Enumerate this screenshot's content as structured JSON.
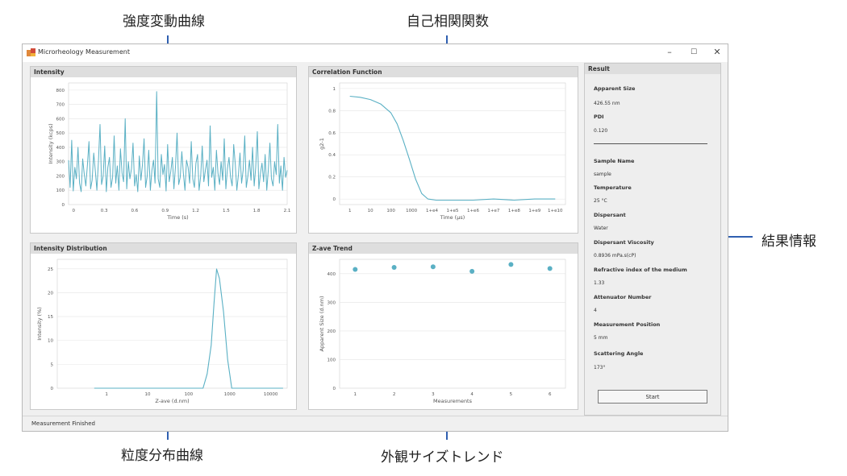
{
  "annotations": {
    "intensity_curve": "強度変動曲線",
    "autocorrelation": "自己相関関数",
    "results_info": "結果情報",
    "size_distribution": "粒度分布曲線",
    "size_trend": "外観サイズトレンド"
  },
  "window": {
    "title": "Microrheology Measurement",
    "minimize": "–",
    "maximize": "☐",
    "close": "✕",
    "status": "Measurement Finished"
  },
  "colors": {
    "line": "#5ab0c4",
    "arrow": "#2f5fb0"
  },
  "chart_data": [
    {
      "id": "intensity",
      "type": "line",
      "title": "Intensity",
      "xlabel": "Time (s)",
      "ylabel": "Intensity (kcps)",
      "xlim": [
        0,
        2.1
      ],
      "ylim": [
        0,
        850
      ],
      "x_ticks": [
        "0",
        "0.3",
        "0.6",
        "0.9",
        "1.2",
        "1.5",
        "1.8",
        "2.1"
      ],
      "y_ticks": [
        "0",
        "100",
        "200",
        "300",
        "400",
        "500",
        "600",
        "700",
        "800"
      ],
      "series": [
        {
          "values": [
            310,
            120,
            450,
            95,
            260,
            180,
            400,
            150,
            90,
            320,
            210,
            130,
            280,
            440,
            110,
            170,
            360,
            240,
            100,
            300,
            560,
            140,
            200,
            410,
            90,
            260,
            330,
            120,
            190,
            480,
            150,
            270,
            100,
            390,
            220,
            160,
            600,
            110,
            300,
            180,
            250,
            430,
            130,
            210,
            90,
            340,
            170,
            280,
            460,
            120,
            200,
            380,
            100,
            240,
            310,
            150,
            790,
            180,
            120,
            350,
            210,
            280,
            95,
            420,
            160,
            230,
            330,
            110,
            270,
            500,
            140,
            190,
            370,
            220,
            100,
            310,
            260,
            150,
            440,
            180,
            120,
            290,
            350,
            100,
            200,
            410,
            160,
            240,
            310,
            130,
            550,
            190,
            260,
            100,
            380,
            220,
            140,
            300,
            170,
            460,
            110,
            250,
            330,
            190,
            130,
            420,
            280,
            100,
            210,
            360,
            150,
            240,
            480,
            120,
            200,
            310,
            170,
            400,
            130,
            260,
            510,
            110,
            220,
            290,
            160,
            350,
            100,
            240,
            430,
            180,
            130,
            300,
            210,
            560,
            150,
            270,
            100,
            330,
            190,
            240
          ]
        }
      ]
    },
    {
      "id": "correlation",
      "type": "line",
      "title": "Correlation Function",
      "xlabel": "Time (µs)",
      "ylabel": "g2-1",
      "ylim": [
        -0.05,
        1.05
      ],
      "x_ticks": [
        "1",
        "10",
        "100",
        "1000",
        "1+e4",
        "1+e5",
        "1+e6",
        "1+e7",
        "1+e8",
        "1+e9",
        "1+e10"
      ],
      "y_ticks": [
        "0",
        "0.2",
        "0.4",
        "0.6",
        "0.8",
        "1"
      ],
      "series": [
        {
          "x": [
            0,
            0.5,
            1,
            1.5,
            2,
            2.3,
            2.6,
            2.9,
            3.2,
            3.5,
            3.8,
            4.2,
            4.6,
            5,
            6,
            7,
            8,
            9,
            10
          ],
          "values": [
            0.93,
            0.92,
            0.9,
            0.86,
            0.78,
            0.68,
            0.53,
            0.36,
            0.18,
            0.05,
            0.0,
            -0.01,
            -0.01,
            -0.01,
            -0.01,
            0.0,
            -0.01,
            0.0,
            0.0
          ]
        }
      ]
    },
    {
      "id": "distribution",
      "type": "line",
      "title": "Intensity Distribution",
      "xlabel": "Z-ave (d.nm)",
      "ylabel": "Intensity (%)",
      "ylim": [
        0,
        27
      ],
      "x_ticks": [
        "1",
        "10",
        "100",
        "1000",
        "10000"
      ],
      "y_ticks": [
        "0",
        "5",
        "10",
        "15",
        "20",
        "25"
      ],
      "series": [
        {
          "x": [
            -0.3,
            2.2,
            2.35,
            2.45,
            2.55,
            2.62,
            2.68,
            2.75,
            2.85,
            2.95,
            3.05,
            4.3
          ],
          "values": [
            0,
            0,
            0,
            3,
            9,
            18,
            25,
            23,
            16,
            6,
            0,
            0
          ]
        }
      ]
    },
    {
      "id": "zave",
      "type": "scatter",
      "title": "Z-ave Trend",
      "xlabel": "Measurements",
      "ylabel": "Apparent Size (d.nm)",
      "ylim": [
        0,
        450
      ],
      "x_ticks": [
        "1",
        "2",
        "3",
        "4",
        "5",
        "6"
      ],
      "y_ticks": [
        "0",
        "100",
        "200",
        "300",
        "400"
      ],
      "series": [
        {
          "x": [
            1,
            2,
            3,
            4,
            5,
            6
          ],
          "values": [
            415,
            422,
            424,
            408,
            432,
            418
          ]
        }
      ]
    }
  ],
  "result": {
    "header": "Result",
    "apparent_size_label": "Apparent Size",
    "apparent_size_value": "426.55 nm",
    "pdi_label": "PDI",
    "pdi_value": "0.120",
    "sample_name_label": "Sample Name",
    "sample_name_value": "sample",
    "temperature_label": "Temperature",
    "temperature_value": "25 °C",
    "dispersant_label": "Dispersant",
    "dispersant_value": "Water",
    "viscosity_label": "Dispersant Viscosity",
    "viscosity_value": "0.8936 mPa.s(cP)",
    "refractive_label": "Refractive index of the medium",
    "refractive_value": "1.33",
    "attenuator_label": "Attenuator Number",
    "attenuator_value": "4",
    "position_label": "Measurement Position",
    "position_value": "5 mm",
    "angle_label": "Scattering Angle",
    "angle_value": "173°",
    "start_button": "Start"
  }
}
